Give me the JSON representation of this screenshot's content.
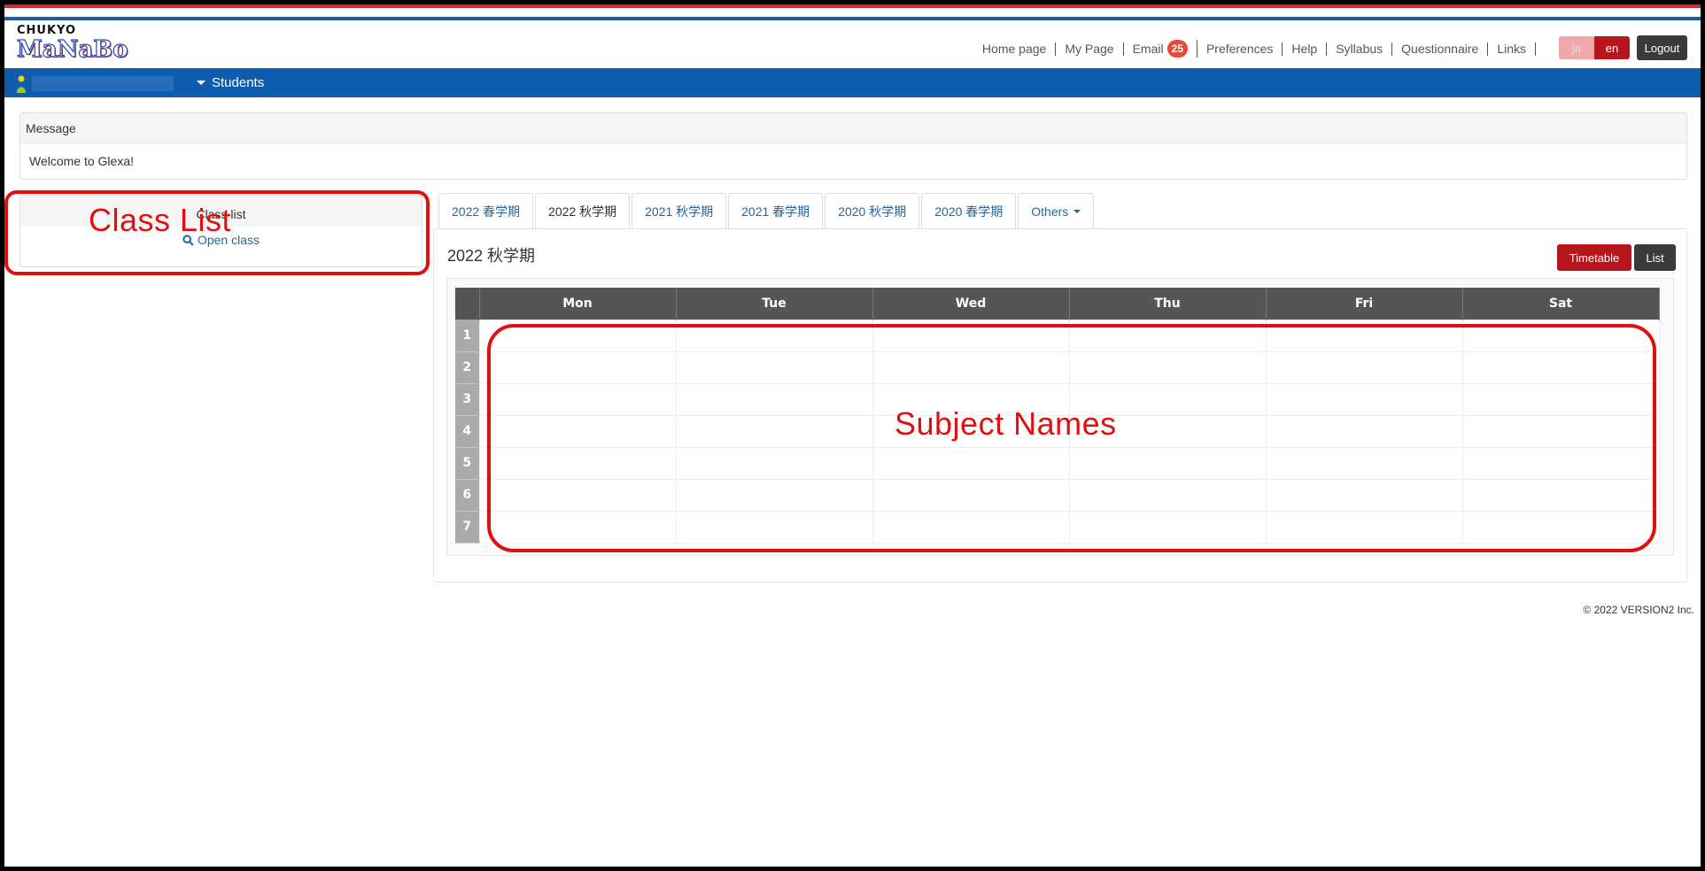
{
  "logo": {
    "top": "CHUKYO",
    "main": "MaNaBo"
  },
  "topnav": [
    "Home page",
    "My Page",
    "Email",
    "Preferences",
    "Help",
    "Syllabus",
    "Questionnaire",
    "Links"
  ],
  "email_badge": "25",
  "lang": {
    "ja": "ja",
    "en": "en"
  },
  "logout": "Logout",
  "userbar": {
    "menu": "Students"
  },
  "message": {
    "title": "Message",
    "body": "Welcome to Glexa!"
  },
  "class_list": {
    "title": "Class list",
    "open_class": "Open class"
  },
  "annotations": {
    "class_list": "Class List",
    "subjects": "Subject Names",
    "color": "#e01010"
  },
  "tabs": [
    "2022 春学期",
    "2022 秋学期",
    "2021 秋学期",
    "2021 春学期",
    "2020 秋学期",
    "2020 春学期",
    "Others"
  ],
  "active_tab": "2022 秋学期",
  "main": {
    "term_title": "2022 秋学期",
    "timetable_button": "Timetable",
    "list_button": "List"
  },
  "timetable": {
    "days": [
      "Mon",
      "Tue",
      "Wed",
      "Thu",
      "Fri",
      "Sat"
    ],
    "periods": [
      "1",
      "2",
      "3",
      "4",
      "5",
      "6",
      "7"
    ]
  },
  "footer": "© 2022 VERSION2 Inc.",
  "colors": {
    "brand_blue": "#0e5cad",
    "brand_red": "#b8161d",
    "stripe_red": "#d7262d"
  }
}
